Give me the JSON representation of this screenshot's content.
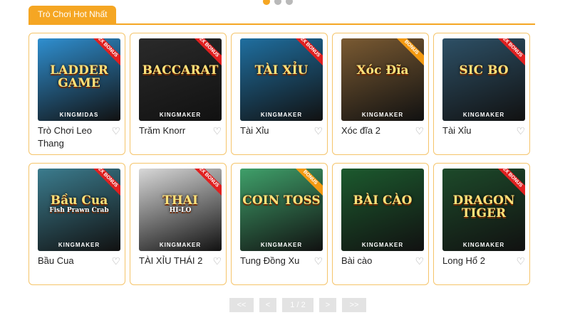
{
  "carousel": {
    "dots": [
      {
        "color": "#f5a623"
      },
      {
        "color": "#b9b9b9"
      },
      {
        "color": "#b9b9b9"
      }
    ]
  },
  "section": {
    "title": "Trò Chơi Hot Nhất"
  },
  "colors": {
    "accent": "#f5a623",
    "card_border": "#f5c46a"
  },
  "games": [
    {
      "title": "Trò Chơi Leo Thang",
      "logo": "LADDER GAME",
      "logo_sub": "",
      "provider": "KINGMIDAS",
      "badge": "2X BONUS",
      "bg": "#2f8fd0",
      "badge_color": "red"
    },
    {
      "title": "Trăm Knorr",
      "logo": "BACCARAT",
      "logo_sub": "",
      "provider": "KINGMAKER",
      "badge": "2X BONUS",
      "bg": "#2a2a2a",
      "badge_color": "red"
    },
    {
      "title": "Tài Xỉu",
      "logo": "TÀI XỈU",
      "logo_sub": "",
      "provider": "KINGMAKER",
      "badge": "2X BONUS",
      "bg": "#1f6fa0",
      "badge_color": "red"
    },
    {
      "title": "Xóc đĩa 2",
      "logo": "Xóc Đĩa",
      "logo_sub": "",
      "provider": "KINGMAKER",
      "badge": "BONUS",
      "bg": "#7a5a32",
      "badge_color": "orange"
    },
    {
      "title": "Tài Xỉu",
      "logo": "SIC BO",
      "logo_sub": "",
      "provider": "KINGMAKER",
      "badge": "2X BONUS",
      "bg": "#2d5066",
      "badge_color": "red"
    },
    {
      "title": "Bầu Cua",
      "logo": "Bầu Cua",
      "logo_sub": "Fish Prawn Crab",
      "provider": "KINGMAKER",
      "badge": "2X BONUS",
      "bg": "#3b7c8e",
      "badge_color": "red"
    },
    {
      "title": "TÀI XỈU THÁI 2",
      "logo": "THAI",
      "logo_sub": "HI-LO",
      "provider": "KINGMAKER",
      "badge": "2X BONUS",
      "bg": "#d8d8d8",
      "badge_color": "red"
    },
    {
      "title": "Tung Đồng Xu",
      "logo": "COIN TOSS",
      "logo_sub": "",
      "provider": "KINGMAKER",
      "badge": "BONUS",
      "bg": "#3fa06a",
      "badge_color": "orange"
    },
    {
      "title": "Bài cào",
      "logo": "BÀI CÀO",
      "logo_sub": "",
      "provider": "KINGMAKER",
      "badge": "",
      "bg": "#1c5a2e",
      "badge_color": "red"
    },
    {
      "title": "Long Hổ 2",
      "logo": "DRAGON TIGER",
      "logo_sub": "",
      "provider": "KINGMAKER",
      "badge": "2X BONUS",
      "bg": "#1d4a2a",
      "badge_color": "red"
    }
  ],
  "pagination": {
    "first": "<<",
    "prev": "<",
    "page_info": "1 / 2",
    "next": ">",
    "last": ">>"
  }
}
